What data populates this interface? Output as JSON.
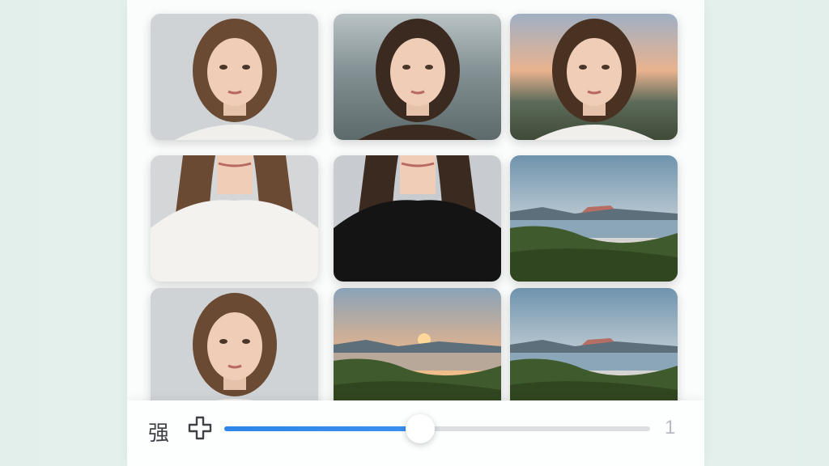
{
  "grid": {
    "tiles": [
      {
        "name": "portrait-tile-1",
        "kind": "portrait",
        "bg": "#cfd3d6",
        "hair": "#6b4a33",
        "top": "#f1efec"
      },
      {
        "name": "portrait-tile-2",
        "kind": "portrait-mist",
        "bg": "#7f8d90",
        "hair": "#3b2a20",
        "top": "#3b2a20"
      },
      {
        "name": "portrait-tile-3",
        "kind": "portrait-sunset",
        "bg": "#e9b38f",
        "hair": "#4a3222",
        "top": "#f1efec"
      },
      {
        "name": "portrait-tile-4",
        "kind": "portrait-crop",
        "bg": "#d4d6d8",
        "hair": "#6b4a33",
        "top": "#f3f2ef"
      },
      {
        "name": "portrait-tile-5",
        "kind": "portrait-crop",
        "bg": "#c8ccd0",
        "hair": "#3b2a20",
        "top": "#141414"
      },
      {
        "name": "landscape-tile-6",
        "kind": "landscape",
        "bg": "#9bb5c8",
        "hill": "#3f5a2c",
        "water": "#8aa6b8"
      },
      {
        "name": "portrait-tile-7",
        "kind": "portrait",
        "bg": "#cfd3d6",
        "hair": "#6b4a33",
        "top": "#f1efec"
      },
      {
        "name": "landscape-tile-8",
        "kind": "landscape-sunset",
        "bg": "#e8b48b",
        "hill": "#3f5a2c",
        "water": "#b7a89a"
      },
      {
        "name": "landscape-tile-9",
        "kind": "landscape",
        "bg": "#9bb5c8",
        "hill": "#3f5a2c",
        "water": "#8aa6b8"
      }
    ]
  },
  "controls": {
    "strength_label": "强",
    "max_label": "1",
    "slider_value": 0.46,
    "accent_color": "#2f86e8",
    "plus_icon": "plus-outline-icon"
  }
}
